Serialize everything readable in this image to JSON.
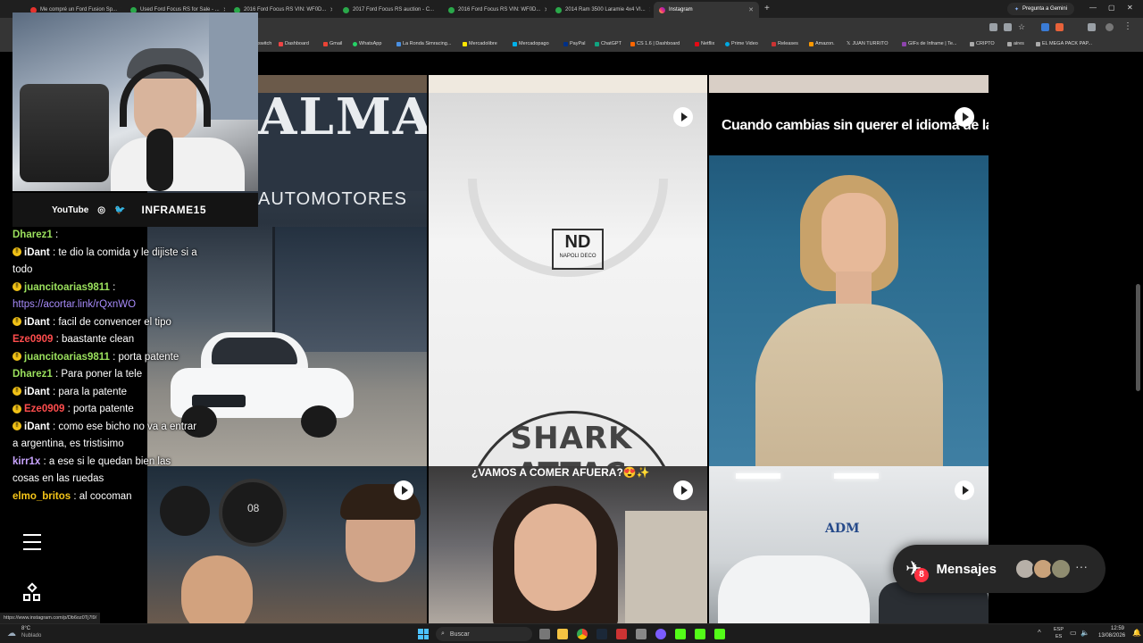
{
  "tabs": [
    {
      "title": "Me compré un Ford Fusion Sp...",
      "active": false
    },
    {
      "title": "Used Ford Focus RS for Sale - ...",
      "active": false
    },
    {
      "title": "2016 Ford Focus RS VIN: WF0D...",
      "active": false
    },
    {
      "title": "2017 Ford Focus RS auction - C...",
      "active": false
    },
    {
      "title": "2016 Ford Focus RS VIN: WF0D...",
      "active": false
    },
    {
      "title": "2014 Ram 3500 Laramie 4x4 VI...",
      "active": false
    },
    {
      "title": "Instagram",
      "active": true
    }
  ],
  "gemini_label": "Pregunta a Gemini",
  "bookmarks": [
    "switch",
    "Dashboard",
    "Gmail",
    "WhatsApp",
    "La Ronda Simracing...",
    "Mercadolibre",
    "Mercadopago",
    "PayPal",
    "ChatGPT",
    "CS 1.6 | Dashboard",
    "Netflix",
    "Prime Video",
    "Releases",
    "Amazon.",
    "JUAN TURRITO",
    "GIFs de Inframe | Te...",
    "CRIPTO",
    "aires",
    "EL MEGA PACK PAP..."
  ],
  "stream": {
    "social": [
      "YouTube",
      "INFRAME15"
    ]
  },
  "chat": [
    {
      "user": "Dharez1",
      "text": " : ",
      "color": "#9be15d"
    },
    {
      "user": "iDant",
      "text": " : te dio la comida y le dijiste si a todo",
      "color": "#ffffff"
    },
    {
      "user": "juancitoarias9811",
      "text": " :",
      "color": "#9be15d"
    },
    {
      "user": "",
      "text": "https://acortar.link/rQxnWO",
      "color": "#a78bfa"
    },
    {
      "user": "iDant",
      "text": " : facil de convencer el tipo",
      "color": "#ffffff"
    },
    {
      "user": "Eze0909",
      "text": " : baastante clean",
      "color": "#ff4d4d"
    },
    {
      "user": "juancitoarias9811",
      "text": " : porta patente",
      "color": "#9be15d"
    },
    {
      "user": "Dharez1",
      "text": " : Para poner la tele",
      "color": "#9be15d"
    },
    {
      "user": "iDant",
      "text": " : para la patente",
      "color": "#ffffff"
    },
    {
      "user": "Eze0909",
      "text": " : porta patente",
      "color": "#ff4d4d"
    },
    {
      "user": "iDant",
      "text": " : como ese bicho no va a entrar a argentina, es tristisimo",
      "color": "#ffffff"
    },
    {
      "user": "kirr1x",
      "text": " : a ese si le quedan bien las cosas en las ruedas",
      "color": "#c9a4ff"
    },
    {
      "user": "elmo_britos",
      "text": " : al cocoman",
      "color": "#f5c518"
    }
  ],
  "posts": {
    "palma_sign": "ALMA",
    "palma_sub": "AUTOMOTORES",
    "meme_caption": "Cuando cambias sin querer el idioma de la serie",
    "shirt_logo": "NAPOLI DECO",
    "shirt_print": "SHARK ATTAC",
    "food_caption": "¿VAMOS A COMER AFUERA?😍✨",
    "adm_sign": "ADM",
    "plate_text": "08"
  },
  "messages": {
    "label": "Mensajes",
    "count": "8"
  },
  "status_url": "https://www.instagram.com/p/Db6oz0Tj7l9/",
  "taskbar": {
    "weather_temp": "8°C",
    "weather_desc": "Nublado",
    "search": "Buscar",
    "lang": "ESP",
    "lang2": "ES",
    "time": "12:59",
    "date": "13/08/2026"
  }
}
